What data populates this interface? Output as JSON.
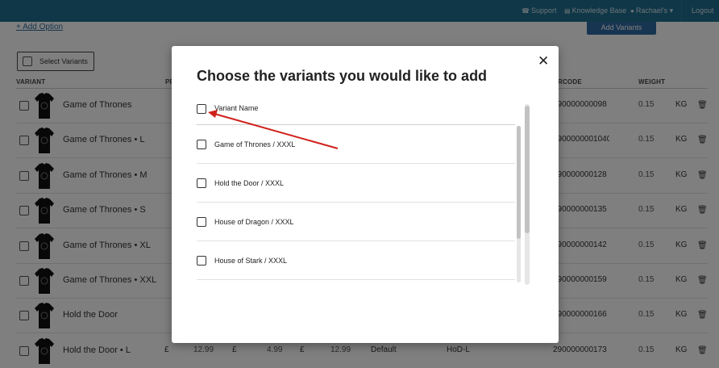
{
  "topbar": {
    "support": "Support",
    "knowledge_base": "Knowledge Base",
    "user": "Rachael's",
    "logout": "Logout"
  },
  "page": {
    "add_option": "+ Add Option",
    "add_variants": "Add Variants",
    "select_variants": "Select Variants",
    "columns": {
      "variant": "VARIANT",
      "price_abbrev": "PR",
      "barcode": "ARCODE",
      "weight": "WEIGHT"
    },
    "rows": [
      {
        "name": "Game of Thrones",
        "barcode": "290000000098",
        "weight": "0.15",
        "unit": "KG"
      },
      {
        "name": "Game of Thrones • L",
        "barcode": "2900000001040290",
        "weight": "0.15",
        "unit": "KG"
      },
      {
        "name": "Game of Thrones • M",
        "barcode": "290000000128",
        "weight": "0.15",
        "unit": "KG"
      },
      {
        "name": "Game of Thrones • S",
        "barcode": "290000000135",
        "weight": "0.15",
        "unit": "KG"
      },
      {
        "name": "Game of Thrones • XL",
        "barcode": "290000000142",
        "weight": "0.15",
        "unit": "KG"
      },
      {
        "name": "Game of Thrones • XXL",
        "barcode": "290000000159",
        "weight": "0.15",
        "unit": "KG"
      },
      {
        "name": "Hold the Door",
        "barcode": "290000000166",
        "weight": "0.15",
        "unit": "KG"
      },
      {
        "name": "Hold the Door • L",
        "barcode": "290000000173",
        "weight": "0.15",
        "unit": "KG",
        "currency": "£",
        "price1": "12.99",
        "price2": "4.99",
        "price3": "12.99",
        "option": "Default",
        "sku": "HoD-L"
      }
    ]
  },
  "modal": {
    "title": "Choose the variants you would like to add",
    "close": "✕",
    "header_label": "Variant Name",
    "items": [
      {
        "label": "Game of Thrones / XXXL"
      },
      {
        "label": "Hold the Door / XXXL"
      },
      {
        "label": "House of Dragon / XXXL"
      },
      {
        "label": "House of Stark / XXXL"
      }
    ]
  },
  "icons": {
    "support": "support-icon",
    "knowledge_base": "book-icon",
    "user": "user-icon",
    "trash": "trash-icon",
    "close": "close-icon"
  },
  "colors": {
    "topbar": "#1e6f8f",
    "button": "#2f6ba3",
    "arrow": "#d0201b"
  }
}
